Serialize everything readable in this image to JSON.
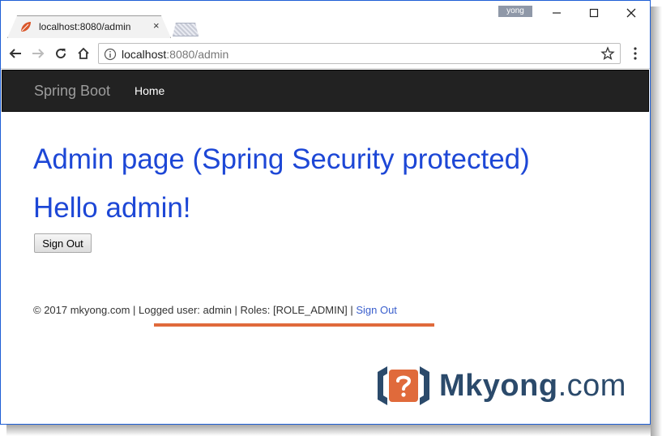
{
  "browser": {
    "tab_title": "localhost:8080/admin",
    "tab_close": "×",
    "user_badge": "yong",
    "url_host": "localhost",
    "url_path": ":8080/admin"
  },
  "navbar": {
    "brand": "Spring Boot",
    "home": "Home"
  },
  "main": {
    "heading": "Admin page (Spring Security protected)",
    "greeting": "Hello admin!",
    "signout_button": "Sign Out"
  },
  "footer": {
    "text": "© 2017 mkyong.com | Logged user: admin | Roles: [ROLE_ADMIN] | ",
    "link": "Sign Out"
  },
  "watermark": {
    "brand": "Mkyong",
    "suffix": ".com",
    "colors": {
      "primary": "#2b4a6b",
      "accent": "#e06a3b"
    }
  },
  "icons": [
    "favicon-leaf-icon",
    "back-arrow-icon",
    "forward-arrow-icon",
    "reload-icon",
    "home-icon",
    "info-icon",
    "star-icon",
    "menu-dots-icon",
    "minimize-icon",
    "maximize-icon",
    "close-icon"
  ]
}
